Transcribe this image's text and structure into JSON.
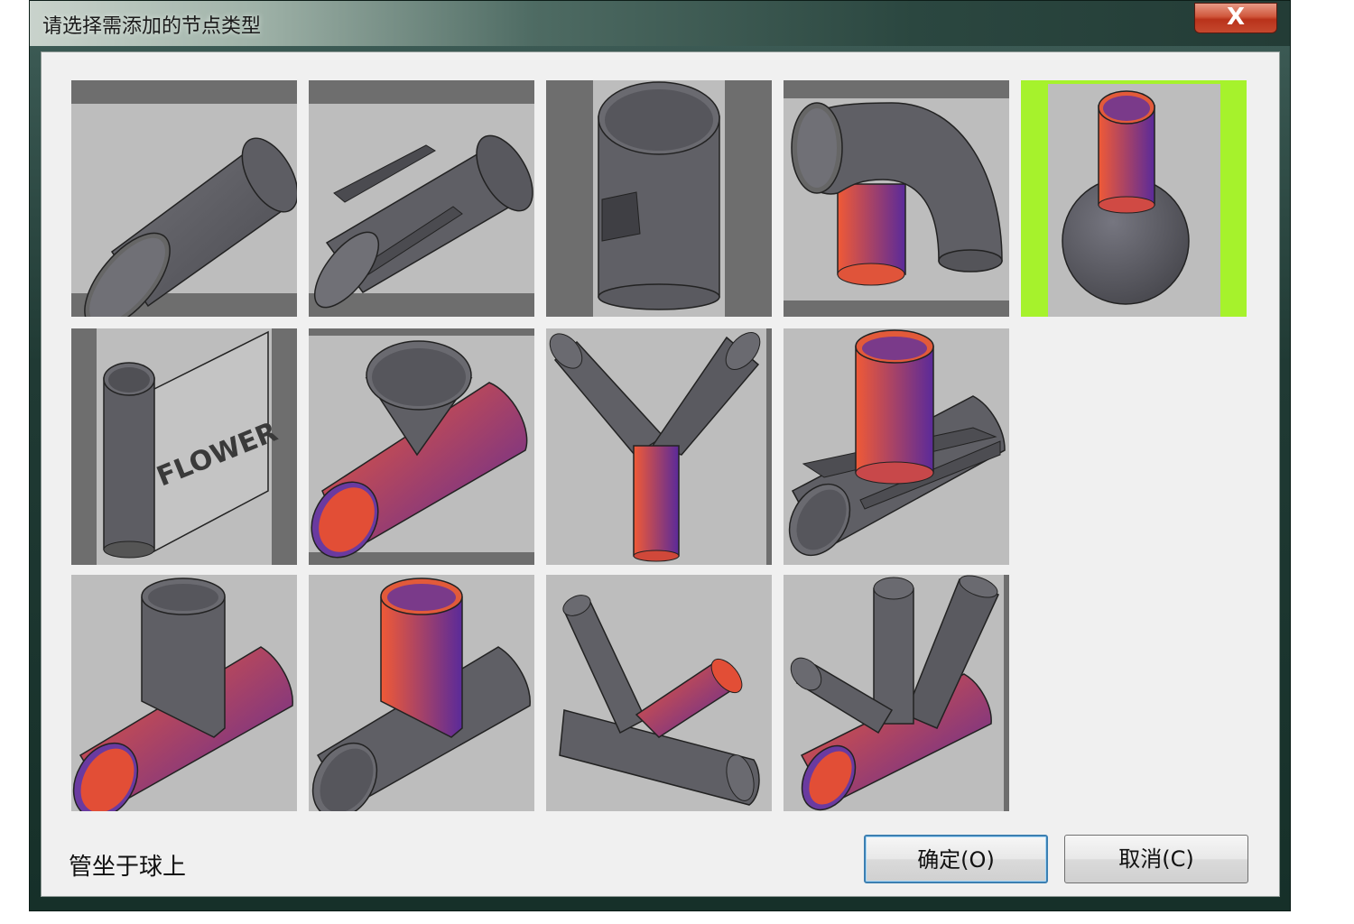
{
  "window": {
    "title": "请选择需添加的节点类型",
    "close_glyph": "X"
  },
  "grid": {
    "selected_index": 4,
    "tiles": [
      {
        "icon": "oblique-cut-pipe-icon"
      },
      {
        "icon": "slotted-pipe-icon"
      },
      {
        "icon": "pipe-with-hole-icon"
      },
      {
        "icon": "elbow-pipe-joint-icon"
      },
      {
        "icon": "pipe-on-ball-icon"
      },
      {
        "icon": "pipe-on-plate-icon",
        "text": "FLOWER"
      },
      {
        "icon": "cone-on-pipe-icon"
      },
      {
        "icon": "y-branch-joint-icon"
      },
      {
        "icon": "pipe-on-plate-over-pipe-icon"
      },
      {
        "icon": "t-joint-gray-branch-icon"
      },
      {
        "icon": "t-joint-colored-branch-icon"
      },
      {
        "icon": "k-joint-icon"
      },
      {
        "icon": "multi-branch-joint-icon"
      }
    ]
  },
  "status_text": "管坐于球上",
  "buttons": {
    "ok_label": "确定(O)",
    "cancel_label": "取消(C)"
  },
  "colors": {
    "pipe_gray": "#5b5b60",
    "accent_gradient_start": "#f05a36",
    "accent_gradient_end": "#5a2a9a",
    "selection_green": "#a6f22c"
  }
}
